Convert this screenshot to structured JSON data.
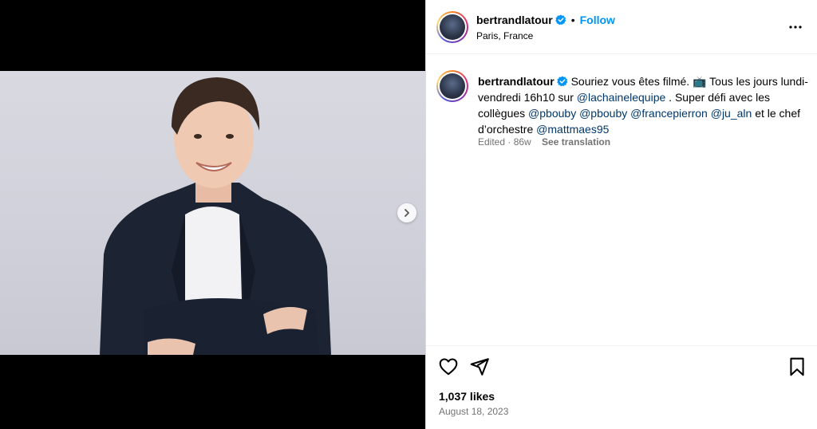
{
  "post": {
    "username": "bertrandlatour",
    "follow_label": "Follow",
    "dot": "•",
    "location": "Paris, France",
    "more_icon": "more-options-icon"
  },
  "caption": {
    "username": "bertrandlatour",
    "text_1": "Souriez vous êtes filmé. 📺 Tous les jours lundi-vendredi 16h10 sur ",
    "mention_1": "@lachainelequipe",
    "text_2": " . Super défi avec les collègues ",
    "mention_2": "@pbouby",
    "text_3": " ",
    "mention_3": "@pbouby",
    "text_4": " ",
    "mention_4": "@francepierron",
    "text_5": " ",
    "mention_5": "@ju_aln",
    "text_6": " et le chef d’orchestre ",
    "mention_6": "@mattmaes95",
    "edited": "Edited · 86w",
    "see_translation": "See translation"
  },
  "footer": {
    "likes": "1,037 likes",
    "date": "August 18, 2023"
  },
  "colors": {
    "accent": "#0095f6",
    "mention": "#00376b",
    "muted": "#737373"
  }
}
